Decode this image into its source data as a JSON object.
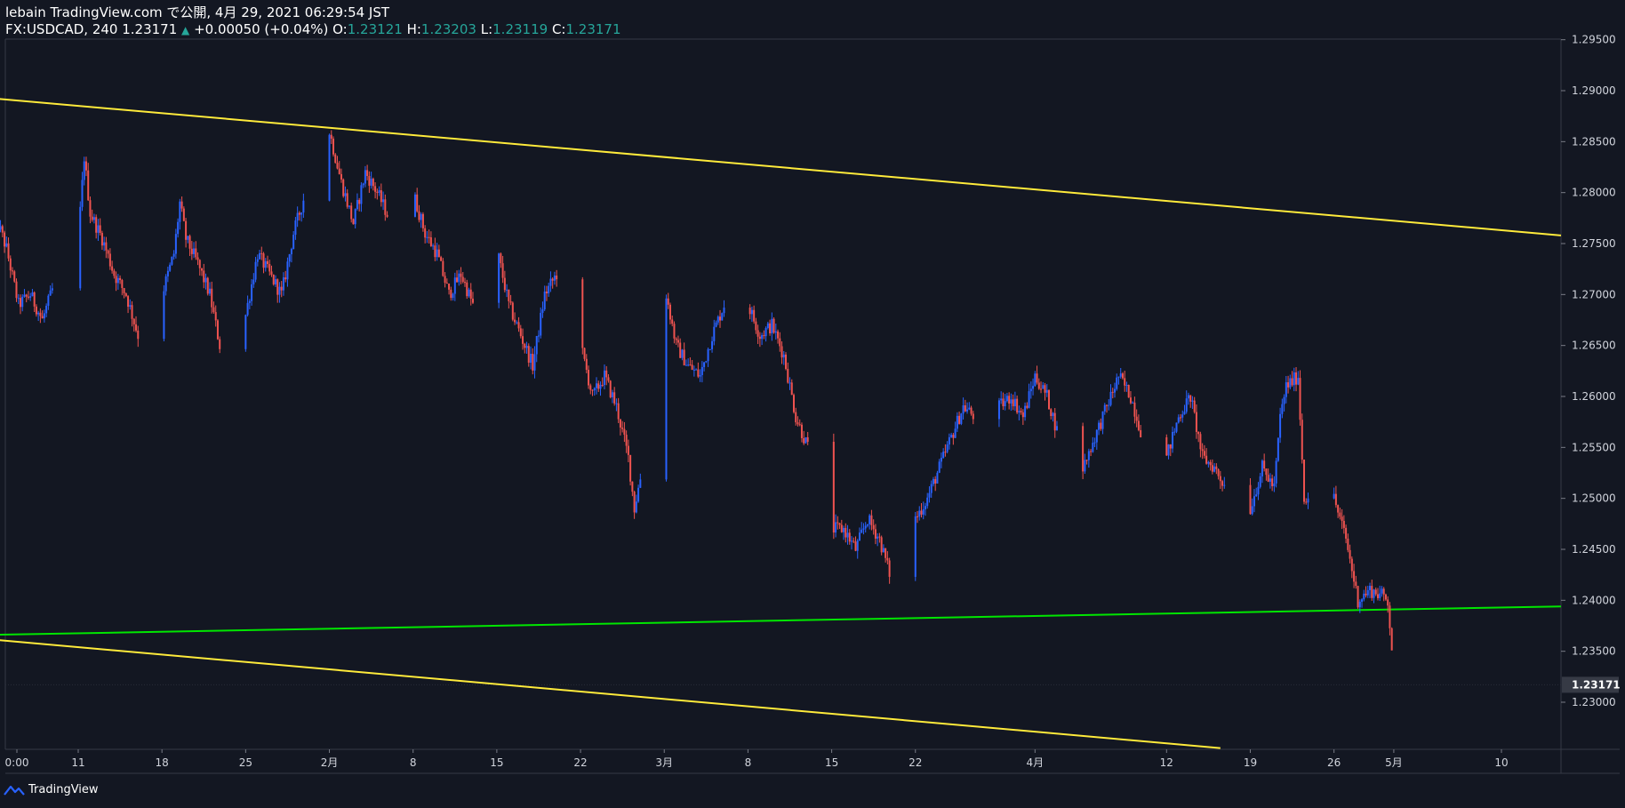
{
  "header": {
    "publisher_line": "lebain TradingView.com で公開, 4月 29, 2021 06:29:54 JST",
    "symbol": "FX:USDCAD, 240 1.23171",
    "change_arrow": "▲",
    "change": "+0.00050 (+0.04%)",
    "o_label": "O:",
    "o_value": "1.23121",
    "h_label": "H:",
    "h_value": "1.23203",
    "l_label": "L:",
    "l_value": "1.23119",
    "c_label": "C:",
    "c_value": "1.23171"
  },
  "footer": {
    "brand": "TradingView"
  },
  "colors": {
    "background": "#131722",
    "up": "#2962ff",
    "down": "#ef5350",
    "trendline_yellow": "#ffeb3b",
    "trendline_green": "#00e600",
    "text": "#ffffff"
  },
  "chart_data": {
    "type": "candlestick",
    "symbol": "FX:USDCAD",
    "interval": "240",
    "ylim": [
      1.2255,
      1.2955
    ],
    "price_ticks": [
      "1.29500",
      "1.29000",
      "1.28500",
      "1.28000",
      "1.27500",
      "1.27000",
      "1.26500",
      "1.26000",
      "1.25500",
      "1.25000",
      "1.24500",
      "1.24000",
      "1.23500",
      "1.23000"
    ],
    "last_price": "1.23171",
    "time_ticks": [
      {
        "label": "0:00",
        "day": 4
      },
      {
        "label": "11",
        "day": 11
      },
      {
        "label": "18",
        "day": 18
      },
      {
        "label": "25",
        "day": 25
      },
      {
        "label": "2月",
        "day": 32
      },
      {
        "label": "8",
        "day": 39
      },
      {
        "label": "15",
        "day": 46
      },
      {
        "label": "22",
        "day": 53
      },
      {
        "label": "3月",
        "day": 60
      },
      {
        "label": "8",
        "day": 67
      },
      {
        "label": "15",
        "day": 74
      },
      {
        "label": "22",
        "day": 81
      },
      {
        "label": "4月",
        "day": 91
      },
      {
        "label": "12",
        "day": 102
      },
      {
        "label": "19",
        "day": 109
      },
      {
        "label": "26",
        "day": 116
      },
      {
        "label": "5月",
        "day": 121
      },
      {
        "label": "10",
        "day": 130
      }
    ],
    "close_path": [
      [
        4,
        1.278
      ],
      [
        5,
        1.2745
      ],
      [
        6,
        1.269
      ],
      [
        7,
        1.27
      ],
      [
        8,
        1.2675
      ],
      [
        9,
        1.271
      ],
      [
        10,
        1.27
      ],
      [
        11,
        1.2755
      ],
      [
        11.5,
        1.2835
      ],
      [
        12,
        1.278
      ],
      [
        13,
        1.2755
      ],
      [
        14,
        1.272
      ],
      [
        15,
        1.27
      ],
      [
        16,
        1.266
      ],
      [
        17,
        1.263
      ],
      [
        18,
        1.27
      ],
      [
        19,
        1.274
      ],
      [
        19.5,
        1.279
      ],
      [
        20,
        1.2755
      ],
      [
        21,
        1.273
      ],
      [
        22,
        1.27
      ],
      [
        23,
        1.264
      ],
      [
        24,
        1.262
      ],
      [
        25,
        1.268
      ],
      [
        26,
        1.274
      ],
      [
        27,
        1.272
      ],
      [
        28,
        1.27
      ],
      [
        29,
        1.276
      ],
      [
        30,
        1.28
      ],
      [
        31,
        1.285
      ],
      [
        32,
        1.286
      ],
      [
        33,
        1.281
      ],
      [
        34,
        1.277
      ],
      [
        35,
        1.282
      ],
      [
        36,
        1.28
      ],
      [
        37,
        1.2775
      ],
      [
        38,
        1.282
      ],
      [
        39,
        1.28
      ],
      [
        40,
        1.276
      ],
      [
        41,
        1.274
      ],
      [
        42,
        1.27
      ],
      [
        43,
        1.272
      ],
      [
        44,
        1.269
      ],
      [
        45,
        1.271
      ],
      [
        46,
        1.2745
      ],
      [
        47,
        1.269
      ],
      [
        48,
        1.266
      ],
      [
        49,
        1.263
      ],
      [
        50,
        1.27
      ],
      [
        51,
        1.272
      ],
      [
        52,
        1.27
      ],
      [
        53,
        1.265
      ],
      [
        54,
        1.26
      ],
      [
        55,
        1.262
      ],
      [
        56,
        1.259
      ],
      [
        57,
        1.254
      ],
      [
        57.5,
        1.249
      ],
      [
        58,
        1.252
      ],
      [
        59,
        1.265
      ],
      [
        59.5,
        1.274
      ],
      [
        60,
        1.271
      ],
      [
        61,
        1.265
      ],
      [
        62,
        1.263
      ],
      [
        63,
        1.262
      ],
      [
        64,
        1.266
      ],
      [
        65,
        1.269
      ],
      [
        66,
        1.264
      ],
      [
        67,
        1.269
      ],
      [
        68,
        1.266
      ],
      [
        69,
        1.267
      ],
      [
        70,
        1.264
      ],
      [
        71,
        1.258
      ],
      [
        72,
        1.255
      ],
      [
        73,
        1.255
      ],
      [
        74,
        1.247
      ],
      [
        75,
        1.247
      ],
      [
        76,
        1.245
      ],
      [
        77,
        1.248
      ],
      [
        78,
        1.246
      ],
      [
        79,
        1.242
      ],
      [
        79.5,
        1.2385
      ],
      [
        80,
        1.243
      ],
      [
        81,
        1.248
      ],
      [
        82,
        1.25
      ],
      [
        83,
        1.253
      ],
      [
        84,
        1.256
      ],
      [
        85,
        1.259
      ],
      [
        86,
        1.258
      ],
      [
        87,
        1.261
      ],
      [
        88,
        1.259
      ],
      [
        89,
        1.26
      ],
      [
        90,
        1.258
      ],
      [
        91,
        1.262
      ],
      [
        92,
        1.26
      ],
      [
        93,
        1.256
      ],
      [
        94,
        1.255
      ],
      [
        95,
        1.253
      ],
      [
        96,
        1.256
      ],
      [
        97,
        1.259
      ],
      [
        98,
        1.262
      ],
      [
        99,
        1.26
      ],
      [
        100,
        1.256
      ],
      [
        101,
        1.255
      ],
      [
        102,
        1.254
      ],
      [
        103,
        1.258
      ],
      [
        104,
        1.26
      ],
      [
        105,
        1.254
      ],
      [
        106,
        1.253
      ],
      [
        107,
        1.251
      ],
      [
        108,
        1.252
      ],
      [
        109,
        1.249
      ],
      [
        110,
        1.253
      ],
      [
        111,
        1.251
      ],
      [
        111.5,
        1.258
      ],
      [
        112,
        1.261
      ],
      [
        113,
        1.262
      ],
      [
        113.5,
        1.25
      ],
      [
        114,
        1.2505
      ],
      [
        115,
        1.25
      ],
      [
        116,
        1.25
      ],
      [
        117,
        1.246
      ],
      [
        118,
        1.24
      ],
      [
        119,
        1.241
      ],
      [
        120,
        1.2405
      ],
      [
        120.5,
        1.24
      ],
      [
        121,
        1.233
      ],
      [
        121.5,
        1.2317
      ]
    ],
    "trendlines": [
      {
        "name": "",
        "color": "#ffeb3b",
        "points": [
          [
            3.3,
            1.2893
          ],
          [
            135,
            1.2758
          ]
        ]
      },
      {
        "name": "",
        "color": "#00e600",
        "points": [
          [
            3.3,
            1.2366
          ],
          [
            135,
            1.2394
          ]
        ]
      },
      {
        "name": "",
        "color": "#ffeb3b",
        "points": [
          [
            3.3,
            1.2362
          ],
          [
            106.5,
            1.2255
          ]
        ]
      }
    ]
  }
}
